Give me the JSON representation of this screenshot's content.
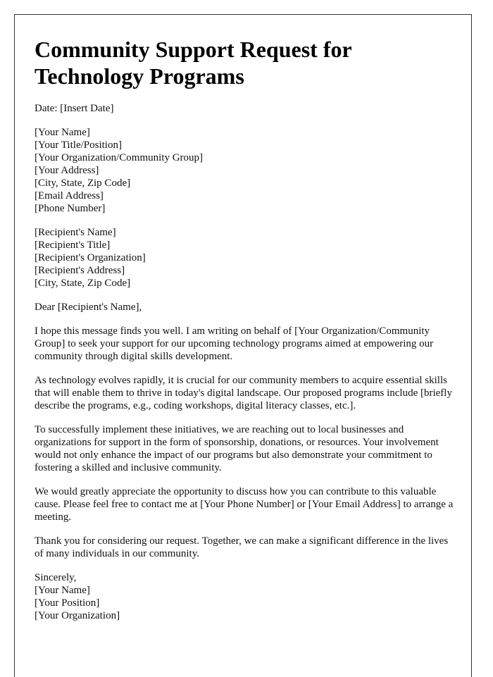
{
  "document": {
    "title": "Community Support Request for Technology Programs",
    "date_line": "Date: [Insert Date]",
    "sender": [
      "[Your Name]",
      "[Your Title/Position]",
      "[Your Organization/Community Group]",
      "[Your Address]",
      "[City, State, Zip Code]",
      "[Email Address]",
      "[Phone Number]"
    ],
    "recipient": [
      "[Recipient's Name]",
      "[Recipient's Title]",
      "[Recipient's Organization]",
      "[Recipient's Address]",
      "[City, State, Zip Code]"
    ],
    "salutation": "Dear [Recipient's Name],",
    "paragraphs": [
      "I hope this message finds you well. I am writing on behalf of [Your Organization/Community Group] to seek your support for our upcoming technology programs aimed at empowering our community through digital skills development.",
      "As technology evolves rapidly, it is crucial for our community members to acquire essential skills that will enable them to thrive in today's digital landscape. Our proposed programs include [briefly describe the programs, e.g., coding workshops, digital literacy classes, etc.].",
      "To successfully implement these initiatives, we are reaching out to local businesses and organizations for support in the form of sponsorship, donations, or resources. Your involvement would not only enhance the impact of our programs but also demonstrate your commitment to fostering a skilled and inclusive community.",
      "We would greatly appreciate the opportunity to discuss how you can contribute to this valuable cause. Please feel free to contact me at [Your Phone Number] or [Your Email Address] to arrange a meeting.",
      "Thank you for considering our request. Together, we can make a significant difference in the lives of many individuals in our community."
    ],
    "closing": "Sincerely,",
    "signature": [
      "[Your Name]",
      "[Your Position]",
      "[Your Organization]"
    ]
  }
}
